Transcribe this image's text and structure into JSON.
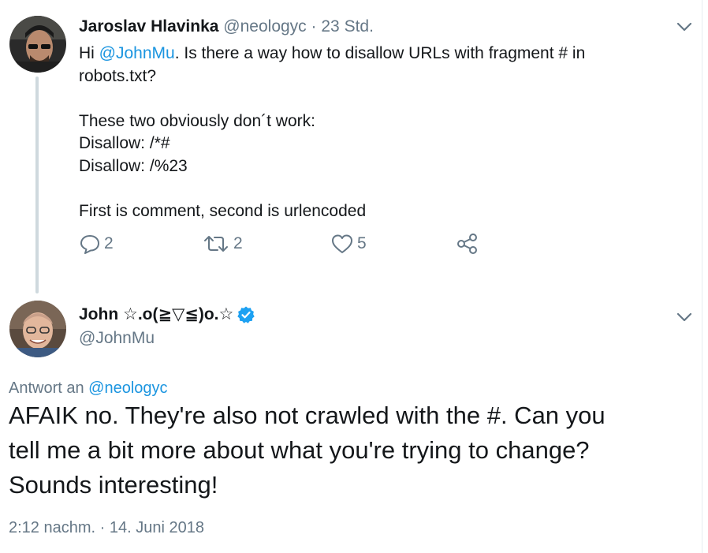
{
  "tweet1": {
    "author_name": "Jaroslav Hlavinka",
    "handle": "@neologyc",
    "separator": "·",
    "time": "23 Std.",
    "text_prefix": "Hi ",
    "mention": "@JohnMu",
    "text_line1_rest": ". Is there a way how to disallow URLs with fragment # in",
    "text_line2": "robots.txt?",
    "text_line3": "These two obviously don´t work:",
    "text_line4": "Disallow: /*#",
    "text_line5": "Disallow: /%23",
    "text_line6": "First is comment, second is urlencoded",
    "actions": {
      "replies": "2",
      "retweets": "2",
      "likes": "5"
    }
  },
  "tweet2": {
    "author_name": "John ☆.o(≧▽≦)o.☆",
    "handle": "@JohnMu",
    "reply_to_label": "Antwort an ",
    "reply_to_handle": "@neologyc",
    "text_line1": "AFAIK no. They're also not crawled with the #. Can you",
    "text_line2": "tell me a bit more about what you're trying to change?",
    "text_line3": "Sounds interesting!",
    "timestamp": "2:12 nachm. · 14. Juni 2018"
  },
  "colors": {
    "link": "#1b95e0",
    "muted": "#657786",
    "text": "#14171a",
    "thread_line": "#cfd9de",
    "verified": "#1da1f2"
  },
  "icons": [
    "chevron-down-icon",
    "reply-icon",
    "retweet-icon",
    "like-icon",
    "share-icon",
    "verified-badge-icon"
  ]
}
